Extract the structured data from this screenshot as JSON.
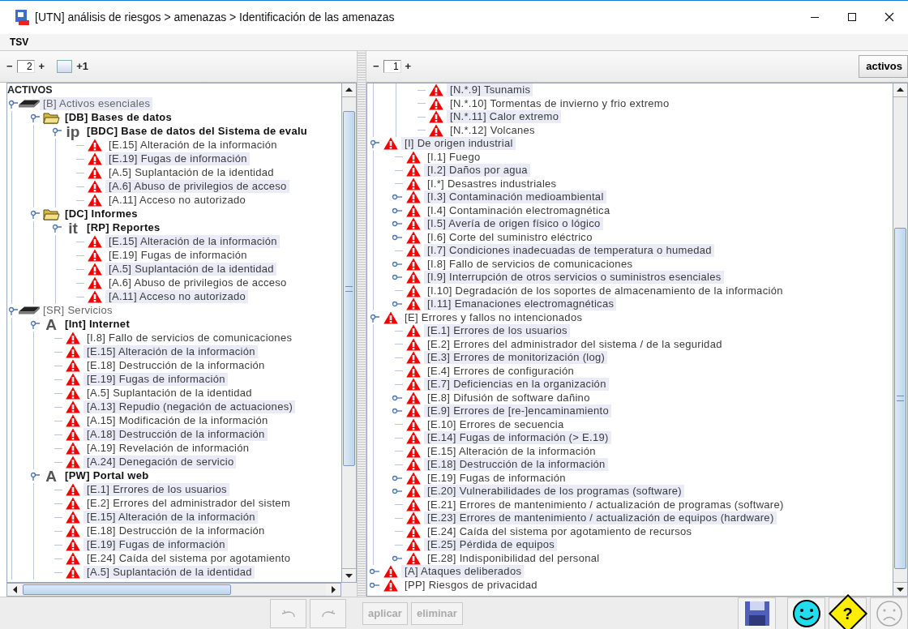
{
  "window": {
    "title": "[UTN] análisis de riesgos > amenazas > Identificación de las amenazas"
  },
  "menu": [
    {
      "label": "TSV"
    }
  ],
  "left_pane": {
    "toolbar": {
      "decrement": "−",
      "value": "2",
      "increment": "+",
      "toggle_checked": false,
      "toggle_label": "+1"
    },
    "tree": {
      "root_label": "ACTIVOS",
      "nodes": [
        {
          "label": "[B] Activos esenciales",
          "kind": "layer",
          "highlighted": true,
          "expanded": true,
          "children": [
            {
              "label": "[DB] Bases de datos",
              "kind": "folder",
              "highlighted": false,
              "expanded": true,
              "children": [
                {
                  "label": "[BDC] Base de datos del Sistema de evalu",
                  "kind": "glyph",
                  "glyph": "ip",
                  "highlighted": false,
                  "expanded": true,
                  "children": [
                    {
                      "label": "[E.15] Alteración de la información",
                      "kind": "threat",
                      "highlighted": false
                    },
                    {
                      "label": "[E.19] Fugas de información",
                      "kind": "threat",
                      "highlighted": true
                    },
                    {
                      "label": "[A.5] Suplantación de la identidad",
                      "kind": "threat",
                      "highlighted": false
                    },
                    {
                      "label": "[A.6] Abuso de privilegios de acceso",
                      "kind": "threat",
                      "highlighted": true
                    },
                    {
                      "label": "[A.11] Acceso no autorizado",
                      "kind": "threat",
                      "highlighted": false
                    }
                  ]
                }
              ]
            },
            {
              "label": "[DC] Informes",
              "kind": "folder",
              "highlighted": false,
              "expanded": true,
              "children": [
                {
                  "label": "[RP] Reportes",
                  "kind": "glyph",
                  "glyph": "it",
                  "highlighted": false,
                  "expanded": true,
                  "children": [
                    {
                      "label": "[E.15] Alteración de la información",
                      "kind": "threat",
                      "highlighted": true
                    },
                    {
                      "label": "[E.19] Fugas de información",
                      "kind": "threat",
                      "highlighted": false
                    },
                    {
                      "label": "[A.5] Suplantación de la identidad",
                      "kind": "threat",
                      "highlighted": true
                    },
                    {
                      "label": "[A.6] Abuso de privilegios de acceso",
                      "kind": "threat",
                      "highlighted": false
                    },
                    {
                      "label": "[A.11] Acceso no autorizado",
                      "kind": "threat",
                      "highlighted": true
                    }
                  ]
                }
              ]
            }
          ]
        },
        {
          "label": "[SR] Servicios",
          "kind": "layer",
          "highlighted": false,
          "expanded": true,
          "children": [
            {
              "label": "[Int] Internet",
              "kind": "glyph",
              "glyph": "A",
              "highlighted": false,
              "expanded": true,
              "children": [
                {
                  "label": "[I.8] Fallo de servicios de comunicaciones",
                  "kind": "threat",
                  "highlighted": false
                },
                {
                  "label": "[E.15] Alteración de la información",
                  "kind": "threat",
                  "highlighted": true
                },
                {
                  "label": "[E.18] Destrucción de la información",
                  "kind": "threat",
                  "highlighted": false
                },
                {
                  "label": "[E.19] Fugas de información",
                  "kind": "threat",
                  "highlighted": true
                },
                {
                  "label": "[A.5] Suplantación de la identidad",
                  "kind": "threat",
                  "highlighted": false
                },
                {
                  "label": "[A.13] Repudio (negación de actuaciones)",
                  "kind": "threat",
                  "highlighted": true
                },
                {
                  "label": "[A.15] Modificación de la información",
                  "kind": "threat",
                  "highlighted": false
                },
                {
                  "label": "[A.18] Destrucción de la información",
                  "kind": "threat",
                  "highlighted": true
                },
                {
                  "label": "[A.19] Revelación de información",
                  "kind": "threat",
                  "highlighted": false
                },
                {
                  "label": "[A.24] Denegación de servicio",
                  "kind": "threat",
                  "highlighted": true
                }
              ]
            },
            {
              "label": "[PW] Portal web",
              "kind": "glyph",
              "glyph": "A",
              "highlighted": false,
              "expanded": true,
              "children": [
                {
                  "label": "[E.1] Errores de los usuarios",
                  "kind": "threat",
                  "highlighted": true
                },
                {
                  "label": "[E.2] Errores del administrador del sistem",
                  "kind": "threat",
                  "highlighted": false
                },
                {
                  "label": "[E.15] Alteración de la información",
                  "kind": "threat",
                  "highlighted": true
                },
                {
                  "label": "[E.18] Destrucción de la información",
                  "kind": "threat",
                  "highlighted": false
                },
                {
                  "label": "[E.19] Fugas de información",
                  "kind": "threat",
                  "highlighted": true
                },
                {
                  "label": "[E.24] Caída del sistema por agotamiento",
                  "kind": "threat",
                  "highlighted": false
                },
                {
                  "label": "[A.5] Suplantación de la identidad",
                  "kind": "threat",
                  "highlighted": true
                }
              ]
            }
          ]
        }
      ]
    }
  },
  "right_pane": {
    "toolbar": {
      "decrement": "−",
      "value": "1",
      "increment": "+",
      "view_button": "activos"
    },
    "tree": {
      "nodes": [
        {
          "children": [
            {
              "children": [
                {
                  "label": "[N.*.9] Tsunamis",
                  "kind": "threat",
                  "highlighted": true
                },
                {
                  "label": "[N.*.10] Tormentas de invierno y frio extremo",
                  "kind": "threat",
                  "highlighted": false
                },
                {
                  "label": "[N.*.11] Calor extremo",
                  "kind": "threat",
                  "highlighted": true
                },
                {
                  "label": "[N.*.12] Volcanes",
                  "kind": "threat",
                  "highlighted": false
                }
              ]
            }
          ]
        },
        {
          "label": "[I] De origen industrial",
          "kind": "threat",
          "highlighted": true,
          "expanded": true,
          "children": [
            {
              "label": "[I.1] Fuego",
              "kind": "threat",
              "highlighted": false
            },
            {
              "label": "[I.2] Daños por agua",
              "kind": "threat",
              "highlighted": true
            },
            {
              "label": "[I.*] Desastres industriales",
              "kind": "threat",
              "highlighted": false
            },
            {
              "label": "[I.3] Contaminación medioambiental",
              "kind": "threat",
              "highlighted": true,
              "expanded": false
            },
            {
              "label": "[I.4] Contaminación electromagnética",
              "kind": "threat",
              "highlighted": false,
              "expanded": false
            },
            {
              "label": "[I.5] Avería de origen físico o lógico",
              "kind": "threat",
              "highlighted": true,
              "expanded": false
            },
            {
              "label": "[I.6] Corte del suministro eléctrico",
              "kind": "threat",
              "highlighted": false,
              "expanded": false
            },
            {
              "label": "[I.7] Condiciones inadecuadas de temperatura o humedad",
              "kind": "threat",
              "highlighted": true
            },
            {
              "label": "[I.8] Fallo de servicios de comunicaciones",
              "kind": "threat",
              "highlighted": false,
              "expanded": false
            },
            {
              "label": "[I.9] Interrupción de otros servicios o suministros esenciales",
              "kind": "threat",
              "highlighted": true,
              "expanded": false
            },
            {
              "label": "[I.10] Degradación de los soportes de almacenamiento de la información",
              "kind": "threat",
              "highlighted": false
            },
            {
              "label": "[I.11] Emanaciones electromagnéticas",
              "kind": "threat",
              "highlighted": true,
              "expanded": false
            }
          ]
        },
        {
          "label": "[E] Errores y fallos no intencionados",
          "kind": "threat",
          "highlighted": false,
          "expanded": true,
          "children": [
            {
              "label": "[E.1] Errores de los usuarios",
              "kind": "threat",
              "highlighted": true
            },
            {
              "label": "[E.2] Errores del administrador del sistema / de la seguridad",
              "kind": "threat",
              "highlighted": false
            },
            {
              "label": "[E.3] Errores de monitorización (log)",
              "kind": "threat",
              "highlighted": true
            },
            {
              "label": "[E.4] Errores de configuración",
              "kind": "threat",
              "highlighted": false
            },
            {
              "label": "[E.7] Deficiencias en la organización",
              "kind": "threat",
              "highlighted": true
            },
            {
              "label": "[E.8] Difusión de software dañino",
              "kind": "threat",
              "highlighted": false,
              "expanded": false
            },
            {
              "label": "[E.9] Errores de [re-]encaminamiento",
              "kind": "threat",
              "highlighted": true,
              "expanded": false
            },
            {
              "label": "[E.10] Errores de secuencia",
              "kind": "threat",
              "highlighted": false
            },
            {
              "label": "[E.14] Fugas de información (> E.19)",
              "kind": "threat",
              "highlighted": true
            },
            {
              "label": "[E.15] Alteración de la información",
              "kind": "threat",
              "highlighted": false
            },
            {
              "label": "[E.18] Destrucción de la información",
              "kind": "threat",
              "highlighted": true
            },
            {
              "label": "[E.19] Fugas de información",
              "kind": "threat",
              "highlighted": false,
              "expanded": false
            },
            {
              "label": "[E.20] Vulnerabilidades de los programas (software)",
              "kind": "threat",
              "highlighted": true,
              "expanded": false
            },
            {
              "label": "[E.21] Errores de mantenimiento / actualización de programas (software)",
              "kind": "threat",
              "highlighted": false
            },
            {
              "label": "[E.23] Errores de mantenimiento / actualización de equipos (hardware)",
              "kind": "threat",
              "highlighted": true
            },
            {
              "label": "[E.24] Caída del sistema por agotamiento de recursos",
              "kind": "threat",
              "highlighted": false
            },
            {
              "label": "[E.25] Pérdida de equipos",
              "kind": "threat",
              "highlighted": true
            },
            {
              "label": "[E.28] Indisponibilidad del personal",
              "kind": "threat",
              "highlighted": false,
              "expanded": false
            }
          ]
        },
        {
          "label": "[A] Ataques deliberados",
          "kind": "threat",
          "highlighted": true,
          "expanded": false
        },
        {
          "label": "[PP] Riesgos de privacidad",
          "kind": "threat",
          "highlighted": false,
          "expanded": false
        }
      ]
    }
  },
  "bottom_bar": {
    "buttons": [
      {
        "kind": "undo",
        "disabled": true
      },
      {
        "kind": "redo",
        "disabled": true
      },
      {
        "kind": "text",
        "label": "aplicar",
        "disabled": true
      },
      {
        "kind": "text",
        "label": "eliminar",
        "disabled": true
      },
      {
        "kind": "save",
        "disabled": false
      },
      {
        "kind": "smiley",
        "disabled": false
      },
      {
        "kind": "help",
        "label": "?",
        "disabled": false
      },
      {
        "kind": "sad",
        "disabled": true
      }
    ]
  }
}
